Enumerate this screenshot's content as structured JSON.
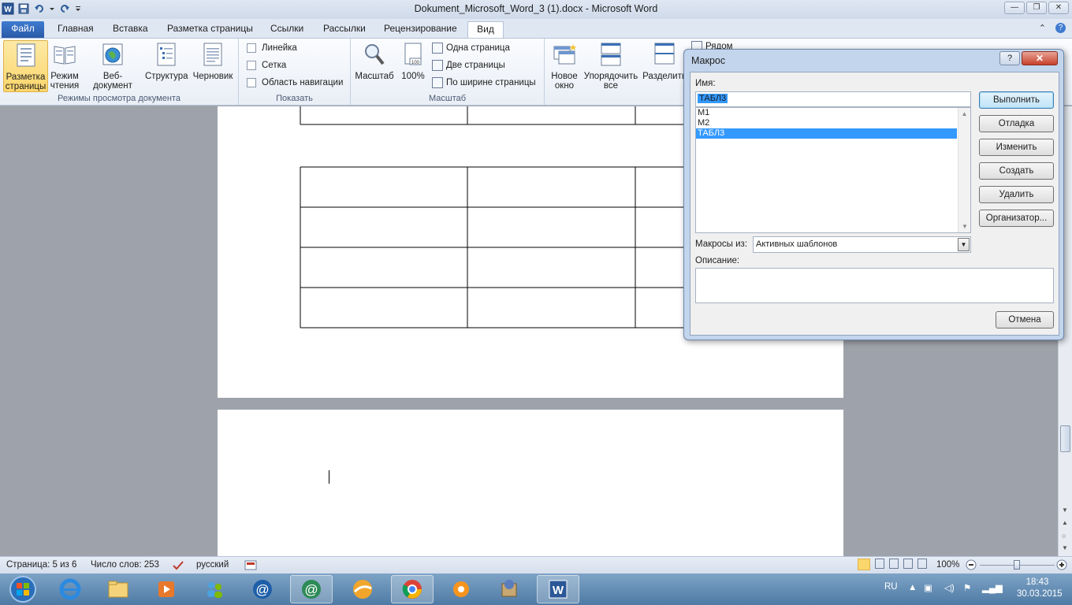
{
  "window": {
    "title": "Dokument_Microsoft_Word_3 (1).docx - Microsoft Word",
    "app_icon": "W"
  },
  "tabs": {
    "file": "Файл",
    "home": "Главная",
    "insert": "Вставка",
    "page_layout": "Разметка страницы",
    "references": "Ссылки",
    "mailings": "Рассылки",
    "review": "Рецензирование",
    "view": "Вид"
  },
  "ribbon": {
    "views": {
      "print_layout_1": "Разметка",
      "print_layout_2": "страницы",
      "reading_1": "Режим",
      "reading_2": "чтения",
      "web": "Веб-документ",
      "outline": "Структура",
      "draft": "Черновик",
      "group": "Режимы просмотра документа"
    },
    "show": {
      "ruler": "Линейка",
      "grid": "Сетка",
      "nav": "Область навигации",
      "group": "Показать"
    },
    "zoom": {
      "zoom": "Масштаб",
      "hundred": "100%",
      "one_page": "Одна страница",
      "two_pages": "Две страницы",
      "page_width": "По ширине страницы",
      "group": "Масштаб"
    },
    "window": {
      "new_1": "Новое",
      "new_2": "окно",
      "arrange_1": "Упорядочить",
      "arrange_2": "все",
      "split": "Разделить",
      "side": "Рядом"
    }
  },
  "status": {
    "page": "Страница: 5 из 6",
    "words": "Число слов: 253",
    "lang": "русский",
    "zoom": "100%"
  },
  "taskbar": {
    "lang": "RU",
    "time": "18:43",
    "date": "30.03.2015"
  },
  "dialog": {
    "title": "Макрос",
    "help": "?",
    "close": "✕",
    "name_label": "Имя:",
    "name_value": "ТАБЛ3",
    "macros": [
      "М1",
      "М2",
      "ТАБЛ3"
    ],
    "selected_index": 2,
    "macros_in_label": "Макросы из:",
    "macros_in_value": "Активных шаблонов",
    "description_label": "Описание:",
    "buttons": {
      "run": "Выполнить",
      "step": "Отладка",
      "edit": "Изменить",
      "create": "Создать",
      "delete": "Удалить",
      "organizer": "Организатор...",
      "cancel": "Отмена"
    }
  }
}
